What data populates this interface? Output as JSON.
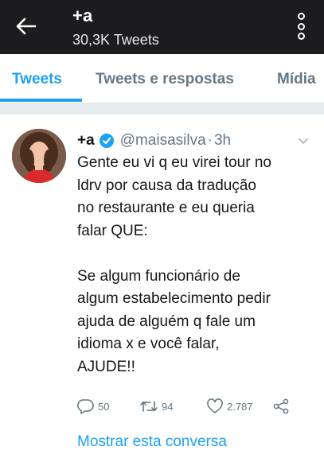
{
  "header": {
    "title": "+a",
    "subtitle": "30,3K Tweets",
    "back_icon": "arrow-left-icon",
    "more_icon": "vertical-dots-icon"
  },
  "tabs": [
    {
      "label": "Tweets",
      "active": true
    },
    {
      "label": "Tweets e respostas",
      "active": false
    },
    {
      "label": "Mídia",
      "active": false
    }
  ],
  "tweet": {
    "author_name": "+a",
    "verified": true,
    "handle": "@maisasilva",
    "separator": "·",
    "time": "3h",
    "text_lines": [
      "Gente eu vi q eu virei tour no",
      "ldrv por causa da tradução",
      "no restaurante e eu queria",
      "falar QUE:",
      "",
      "Se algum funcionário de",
      "algum estabelecimento pedir",
      "ajuda de alguém q fale um",
      "idioma x e você falar,",
      "AJUDE!!"
    ],
    "actions": {
      "replies": "50",
      "retweets": "94",
      "likes": "2.787"
    },
    "show_thread": "Mostrar esta conversa"
  },
  "colors": {
    "accent": "#1da1f2",
    "topbar": "#1c1c1e",
    "muted": "#657786",
    "retweet_icon": "#657786",
    "verified_badge": "#1da1f2"
  }
}
